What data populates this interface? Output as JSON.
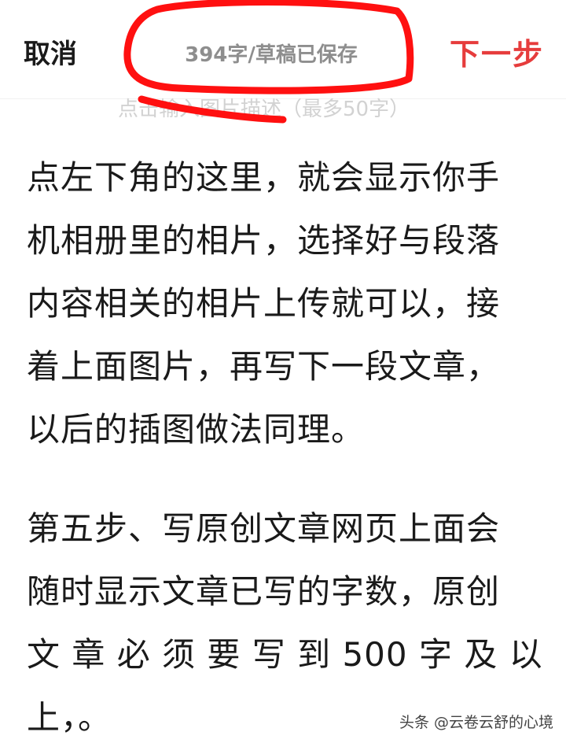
{
  "header": {
    "cancel_label": "取消",
    "status_text": "394字/草稿已保存",
    "next_label": "下一步"
  },
  "colors": {
    "accent_red": "#e63c3c",
    "marker_red": "#ff1010",
    "status_gray": "#8e8e8e",
    "placeholder_gray": "#d2d2d2"
  },
  "image_caption": {
    "placeholder": "点击输入图片描述（最多50字）"
  },
  "article": {
    "paragraphs": [
      "点左下角的这里，就会显示你手\n机相册里的相片，选择好与段落\n内容相关的相片上传就可以，接\n着上面图片，再写下一段文章，\n以后的插图做法同理。",
      "第五步、写原创文章网页上面会\n随时显示文章已写的字数，原创\n文 章 必 须 要 写 到 500 字 及 以\n上，。"
    ]
  },
  "watermark": "头条 @云卷云舒的心境"
}
